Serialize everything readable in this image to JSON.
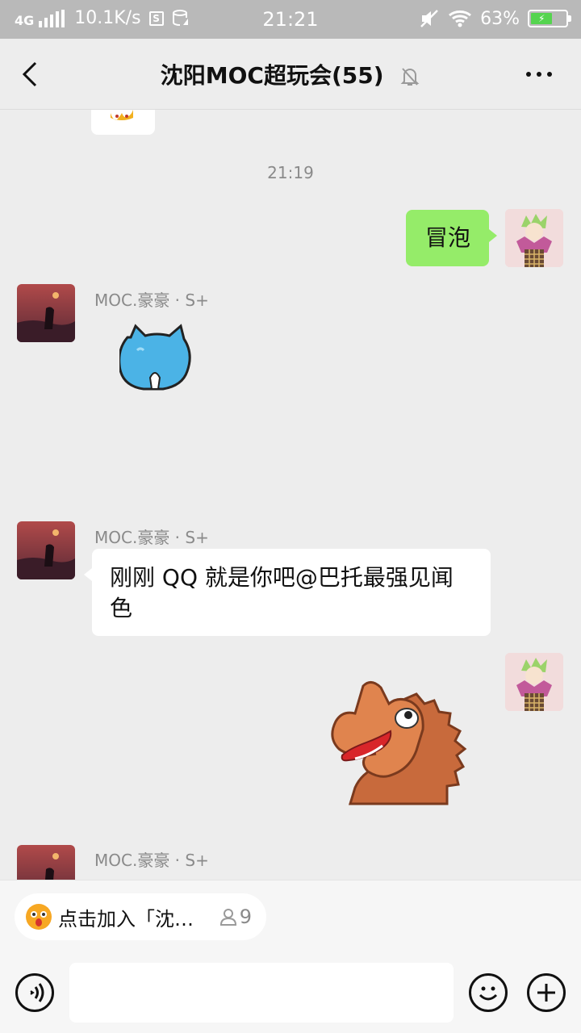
{
  "status_bar": {
    "network": "4G",
    "speed": "10.1K/s",
    "time": "21:21",
    "battery": "63%"
  },
  "nav": {
    "title": "沈阳MOC超玩会(55)"
  },
  "chat": {
    "timestamp": "21:19",
    "messages": [
      {
        "sender": "self",
        "type": "text",
        "text": "冒泡"
      },
      {
        "sender": "MOC.豪豪 · S+",
        "type": "sticker",
        "sticker": "blue-cat-sticker"
      },
      {
        "sender": "MOC.豪豪 · S+",
        "type": "text",
        "text": "刚刚 QQ 就是你吧@巴托最强见闻色"
      },
      {
        "sender": "self",
        "type": "sticker",
        "sticker": "horse-sticker"
      },
      {
        "sender": "MOC.豪豪 · S+",
        "type": "partial"
      }
    ]
  },
  "join_bar": {
    "label": "点击加入「沈…",
    "count": "9"
  },
  "colors": {
    "self_bubble": "#95ec69",
    "other_bubble": "#ffffff",
    "background": "#ededed"
  }
}
